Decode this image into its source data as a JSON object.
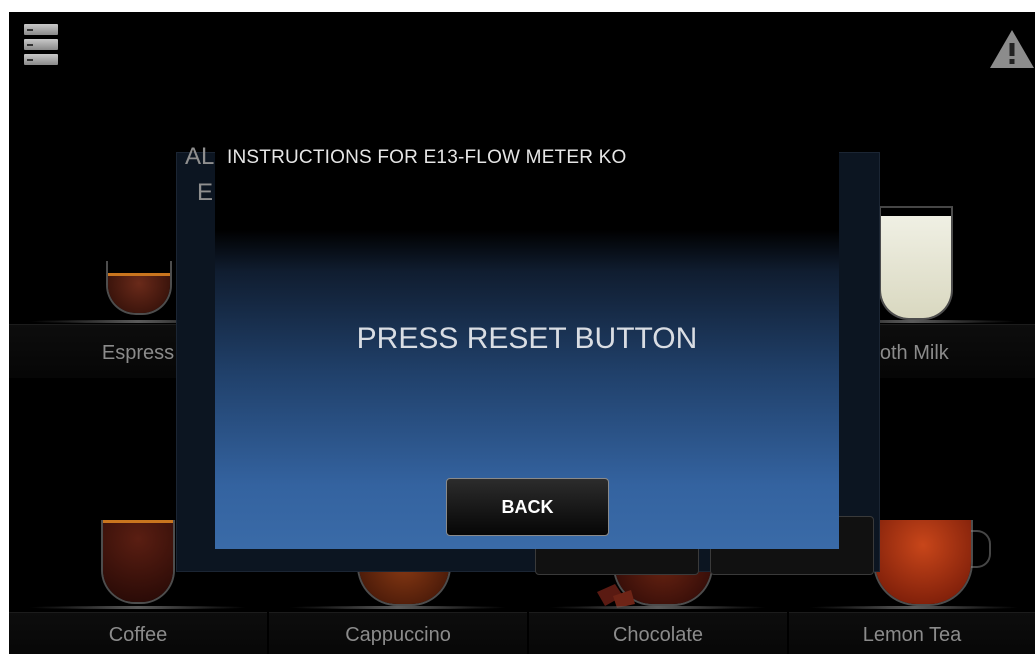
{
  "products": [
    {
      "id": "espresso",
      "label": "Espress"
    },
    {
      "id": "froth-milk",
      "label": "roth Milk"
    },
    {
      "id": "coffee",
      "label": "Coffee"
    },
    {
      "id": "cappuccino",
      "label": "Cappuccino"
    },
    {
      "id": "chocolate",
      "label": "Chocolate"
    },
    {
      "id": "lemon-tea",
      "label": "Lemon Tea"
    }
  ],
  "alarm_panel": {
    "title_fragment": "AL",
    "code_fragment": "E"
  },
  "dialog": {
    "title": "INSTRUCTIONS FOR E13-FLOW METER KO",
    "message": "PRESS RESET BUTTON",
    "back_label": "BACK"
  },
  "icons": {
    "menu": "menu-icon",
    "warning": "warning-icon"
  },
  "colors": {
    "dialog_blue": "#3a6ba8",
    "crema": "#c9751e",
    "tea": "#b23a10"
  }
}
